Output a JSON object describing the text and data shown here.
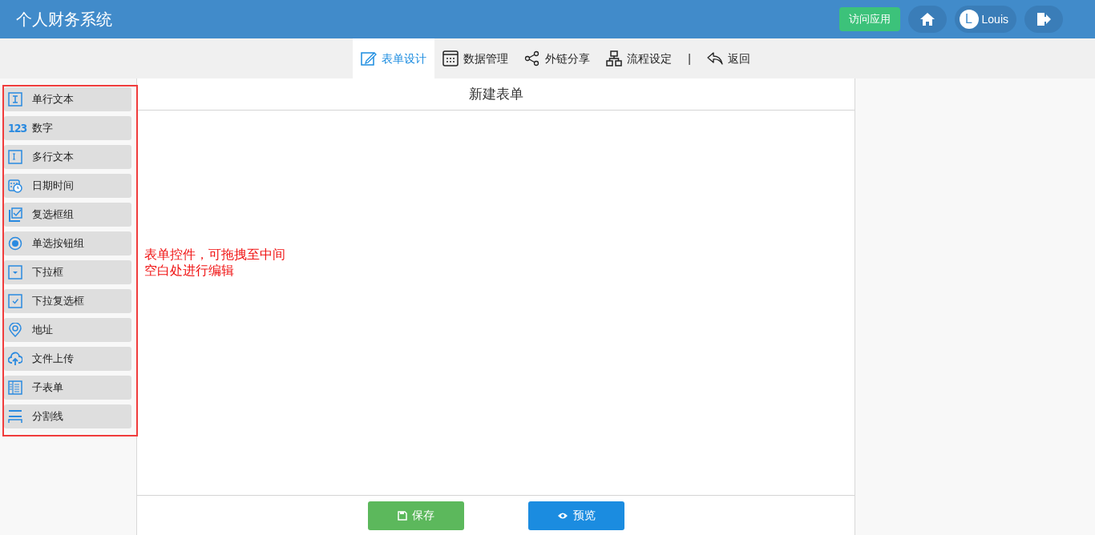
{
  "header": {
    "title": "个人财务系统",
    "visit_button": "访问应用",
    "user": {
      "initial": "L",
      "name": "Louis"
    }
  },
  "nav": {
    "tabs": [
      {
        "kind": "design",
        "label": "表单设计",
        "selected": true
      },
      {
        "kind": "data",
        "label": "数据管理",
        "selected": false
      },
      {
        "kind": "share",
        "label": "外链分享",
        "selected": false
      },
      {
        "kind": "flow",
        "label": "流程设定",
        "selected": false
      }
    ],
    "separator": "|",
    "back": "返回"
  },
  "palette": [
    {
      "kind": "text",
      "label": "单行文本"
    },
    {
      "kind": "number",
      "icon_text": "123",
      "label": "数字"
    },
    {
      "kind": "textarea",
      "label": "多行文本"
    },
    {
      "kind": "datetime",
      "label": "日期时间"
    },
    {
      "kind": "checkbox",
      "label": "复选框组"
    },
    {
      "kind": "radio",
      "label": "单选按钮组"
    },
    {
      "kind": "select",
      "label": "下拉框"
    },
    {
      "kind": "multiselect",
      "label": "下拉复选框"
    },
    {
      "kind": "address",
      "label": "地址"
    },
    {
      "kind": "upload",
      "label": "文件上传"
    },
    {
      "kind": "subform",
      "label": "子表单"
    },
    {
      "kind": "divider",
      "label": "分割线"
    }
  ],
  "annotation": "表单控件，可拖拽至中间空白处进行编辑",
  "form": {
    "title": "新建表单",
    "save_button": "保存",
    "preview_button": "预览"
  }
}
